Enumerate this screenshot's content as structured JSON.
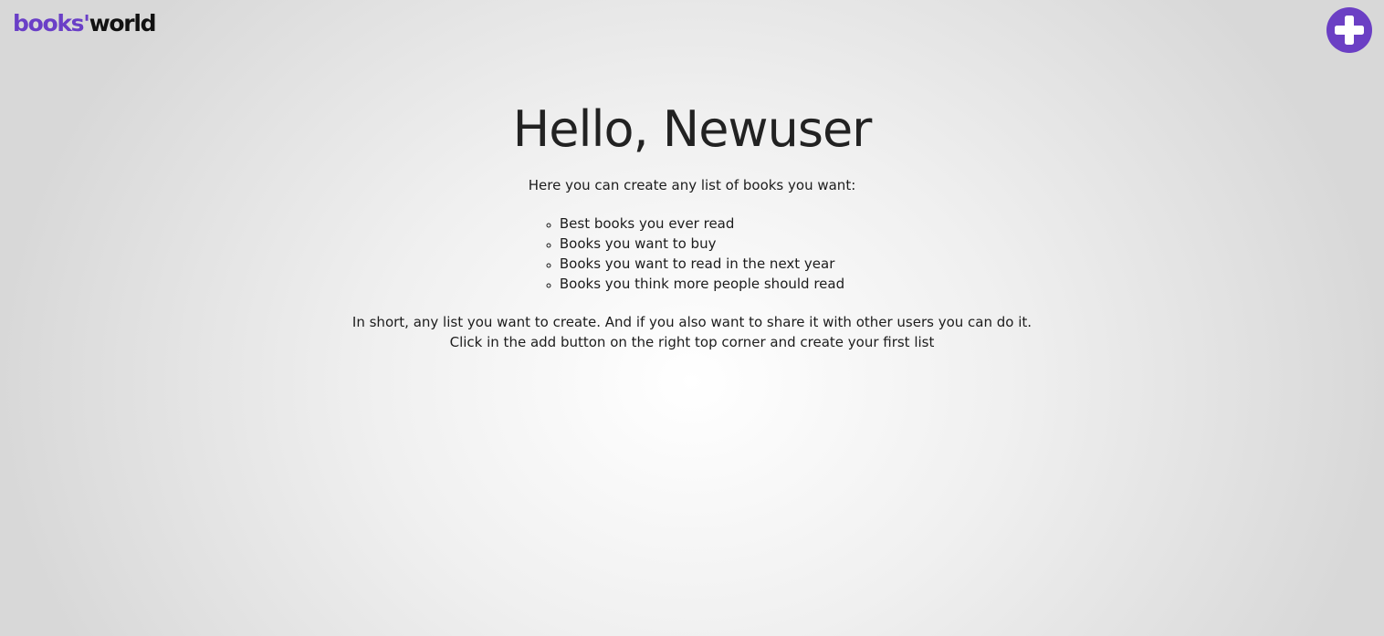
{
  "header": {
    "logo": {
      "part1": "books",
      "apostrophe": "'",
      "part2": "world"
    },
    "add_button_icon": "plus-icon"
  },
  "main": {
    "greeting": "Hello, Newuser",
    "intro": "Here you can create any list of books you want:",
    "examples": [
      "Best books you ever read",
      "Books you want to buy",
      "Books you want to read in the next year",
      "Books you think more people should read"
    ],
    "outro_line1": "In short, any list you want to create. And if you also want to share it with other users you can do it.",
    "outro_line2": "Click in the add button on the right top corner and create your first list"
  },
  "colors": {
    "brand": "#6b3fc4",
    "text": "#1c1c1c",
    "background": "#e8e8e8"
  }
}
